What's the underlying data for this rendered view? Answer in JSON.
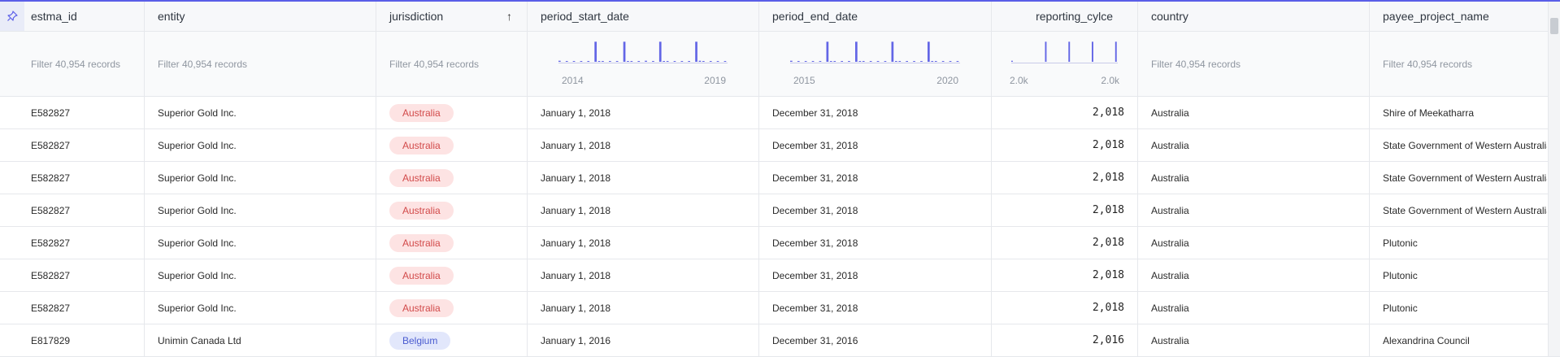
{
  "columns": {
    "estma_id": "estma_id",
    "entity": "entity",
    "jurisdiction": "jurisdiction",
    "period_start_date": "period_start_date",
    "period_end_date": "period_end_date",
    "reporting_cycle": "reporting_cylce",
    "country": "country",
    "payee_project_name": "payee_project_name"
  },
  "sort": {
    "column": "jurisdiction",
    "direction": "ascending",
    "icon": "arrow-up-icon"
  },
  "filter_placeholder": "Filter 40,954 records",
  "colors": {
    "accent": "#5a5ee8",
    "badge_red_bg": "#fde3e3",
    "badge_red_text": "#d24a4a",
    "badge_blue_bg": "#e2e7fb",
    "badge_blue_text": "#4a5bd0",
    "bar": "#6366e6"
  },
  "histograms": {
    "period_start_date": {
      "axis_min_label": "2014",
      "axis_max_label": "2019",
      "bars": [
        0.05,
        0,
        0.02,
        0,
        0.03,
        0,
        0.03,
        0,
        0.02,
        0,
        0.95,
        0.02,
        0.03,
        0,
        0.04,
        0,
        0.02,
        0,
        0.95,
        0.04,
        0.03,
        0,
        0.02,
        0,
        0.05,
        0,
        0.03,
        0,
        0.95,
        0.02,
        0.03,
        0,
        0.02,
        0,
        0.04,
        0,
        0.02,
        0,
        0.95,
        0.05,
        0.02,
        0,
        0.03,
        0,
        0.02,
        0,
        0.02
      ]
    },
    "period_end_date": {
      "axis_min_label": "2015",
      "axis_max_label": "2020",
      "bars": [
        0.05,
        0,
        0.02,
        0,
        0.02,
        0,
        0.03,
        0,
        0.02,
        0,
        0.95,
        0.02,
        0.03,
        0,
        0.04,
        0,
        0.02,
        0,
        0.95,
        0.02,
        0.03,
        0,
        0.02,
        0,
        0.04,
        0,
        0.02,
        0,
        0.95,
        0.02,
        0.04,
        0,
        0.02,
        0,
        0.03,
        0,
        0.02,
        0,
        0.95,
        0.04,
        0.02,
        0,
        0.03,
        0,
        0.02,
        0,
        0.02
      ]
    },
    "reporting_cycle": {
      "axis_min_label": "2.0k",
      "axis_max_label": "2.0k",
      "bars": [
        0.05,
        0,
        0,
        0,
        0,
        0,
        0,
        0,
        0,
        0,
        0,
        0,
        0,
        0.95,
        0,
        0,
        0,
        0,
        0,
        0,
        0,
        0,
        0.95,
        0,
        0,
        0,
        0,
        0,
        0,
        0,
        0,
        0.95,
        0,
        0,
        0,
        0,
        0,
        0,
        0,
        0,
        0.95
      ]
    }
  },
  "rows": [
    {
      "estma_id": "E582827",
      "entity": "Superior Gold Inc.",
      "jurisdiction": "Australia",
      "badge": "red",
      "period_start_date": "January 1, 2018",
      "period_end_date": "December 31, 2018",
      "reporting_cycle": "2,018",
      "country": "Australia",
      "payee_project_name": "Shire of Meekatharra"
    },
    {
      "estma_id": "E582827",
      "entity": "Superior Gold Inc.",
      "jurisdiction": "Australia",
      "badge": "red",
      "period_start_date": "January 1, 2018",
      "period_end_date": "December 31, 2018",
      "reporting_cycle": "2,018",
      "country": "Australia",
      "payee_project_name": "State Government of Western Australia"
    },
    {
      "estma_id": "E582827",
      "entity": "Superior Gold Inc.",
      "jurisdiction": "Australia",
      "badge": "red",
      "period_start_date": "January 1, 2018",
      "period_end_date": "December 31, 2018",
      "reporting_cycle": "2,018",
      "country": "Australia",
      "payee_project_name": "State Government of Western Australia"
    },
    {
      "estma_id": "E582827",
      "entity": "Superior Gold Inc.",
      "jurisdiction": "Australia",
      "badge": "red",
      "period_start_date": "January 1, 2018",
      "period_end_date": "December 31, 2018",
      "reporting_cycle": "2,018",
      "country": "Australia",
      "payee_project_name": "State Government of Western Australia"
    },
    {
      "estma_id": "E582827",
      "entity": "Superior Gold Inc.",
      "jurisdiction": "Australia",
      "badge": "red",
      "period_start_date": "January 1, 2018",
      "period_end_date": "December 31, 2018",
      "reporting_cycle": "2,018",
      "country": "Australia",
      "payee_project_name": "Plutonic"
    },
    {
      "estma_id": "E582827",
      "entity": "Superior Gold Inc.",
      "jurisdiction": "Australia",
      "badge": "red",
      "period_start_date": "January 1, 2018",
      "period_end_date": "December 31, 2018",
      "reporting_cycle": "2,018",
      "country": "Australia",
      "payee_project_name": "Plutonic"
    },
    {
      "estma_id": "E582827",
      "entity": "Superior Gold Inc.",
      "jurisdiction": "Australia",
      "badge": "red",
      "period_start_date": "January 1, 2018",
      "period_end_date": "December 31, 2018",
      "reporting_cycle": "2,018",
      "country": "Australia",
      "payee_project_name": "Plutonic"
    },
    {
      "estma_id": "E817829",
      "entity": "Unimin Canada Ltd",
      "jurisdiction": "Belgium",
      "badge": "blue",
      "period_start_date": "January 1, 2016",
      "period_end_date": "December 31, 2016",
      "reporting_cycle": "2,016",
      "country": "Australia",
      "payee_project_name": "Alexandrina Council"
    }
  ]
}
